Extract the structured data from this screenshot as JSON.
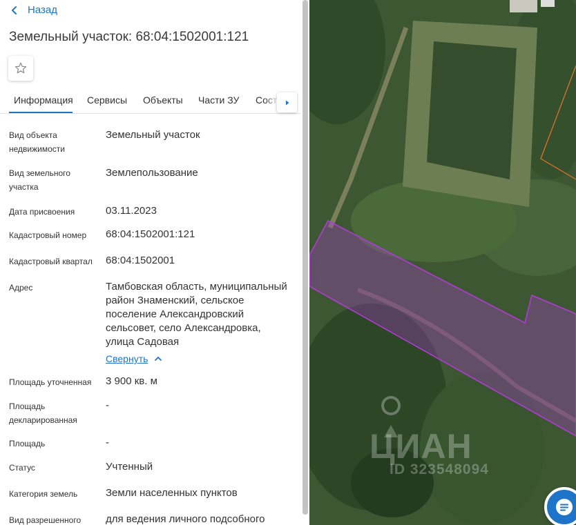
{
  "nav": {
    "back_label": "Назад"
  },
  "header": {
    "title": "Земельный участок: 68:04:1502001:121"
  },
  "tabs": [
    {
      "label": "Информация",
      "active": true
    },
    {
      "label": "Сервисы",
      "active": false
    },
    {
      "label": "Объекты",
      "active": false
    },
    {
      "label": "Части ЗУ",
      "active": false
    },
    {
      "label": "Состав",
      "active": false
    }
  ],
  "details": [
    {
      "label": "Вид объекта недвижимости",
      "value": "Земельный участок"
    },
    {
      "label": "Вид земельного участка",
      "value": "Землепользование"
    },
    {
      "label": "Дата присвоения",
      "value": "03.11.2023"
    },
    {
      "label": "Кадастровый номер",
      "value": "68:04:1502001:121"
    },
    {
      "label": "Кадастровый квартал",
      "value": "68:04:1502001"
    },
    {
      "label": "Адрес",
      "value": "Тамбовская область, муниципальный район Знаменский, сельское поселение Александровский сельсовет, село Александровка, улица Садовая"
    },
    {
      "label": "Площадь уточненная",
      "value": "3 900 кв. м"
    },
    {
      "label": "Площадь декларированная",
      "value": "-"
    },
    {
      "label": "Площадь",
      "value": "-"
    },
    {
      "label": "Статус",
      "value": "Учтенный"
    },
    {
      "label": "Категория земель",
      "value": "Земли населенных пунктов"
    },
    {
      "label": "Вид разрешенного",
      "value": "для ведения личного подсобного"
    }
  ],
  "address_toggle": {
    "label": "Свернуть"
  },
  "map": {
    "watermark_brand": "ЦИАН",
    "watermark_id": "ID 323548094",
    "parcel_color": "#b23bd8",
    "neighbor_color": "#e0702a"
  },
  "colors": {
    "accent": "#1e74c9"
  }
}
